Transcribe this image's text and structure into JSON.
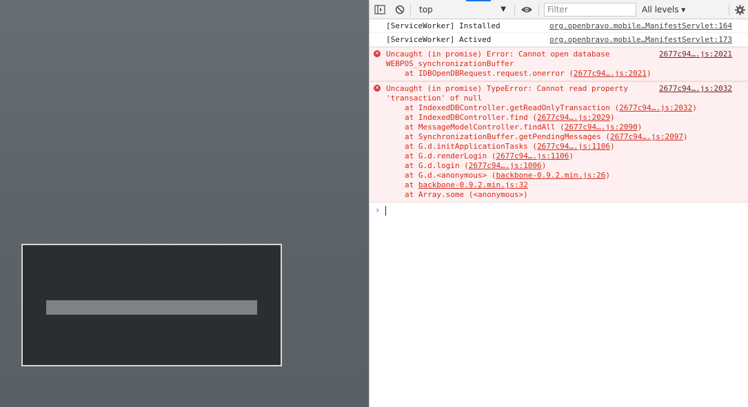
{
  "app": {
    "progress": 1.0
  },
  "devtools": {
    "toolbar": {
      "sidebar_icon": "sidebar-toggle-icon",
      "clear_icon": "clear-console-icon",
      "context": "top",
      "eye_icon": "eye-icon",
      "filter_placeholder": "Filter",
      "levels": "All levels ▾",
      "settings_icon": "gear-icon"
    },
    "messages": [
      {
        "type": "info",
        "text": "[ServiceWorker] Installed",
        "source": "org.openbravo.mobile…ManifestServlet:164"
      },
      {
        "type": "info",
        "text": "[ServiceWorker] Actived",
        "source": "org.openbravo.mobile…ManifestServlet:173"
      }
    ],
    "error1": {
      "line1": "Uncaught (in promise) Error: Cannot open database",
      "line2": "WEBPOS_synchronizationBuffer",
      "source": "2677c94….js:2021",
      "stack": [
        {
          "prefix": "at IDBOpenDBRequest.request.onerror (",
          "link": "2677c94….js:2021",
          "suffix": ")"
        }
      ]
    },
    "error2": {
      "line1": "Uncaught (in promise) TypeError: Cannot read property",
      "line2": "'transaction' of null",
      "source": "2677c94….js:2032",
      "stack": [
        {
          "prefix": "at IndexedDBController.getReadOnlyTransaction (",
          "link": "2677c94….js:2032",
          "suffix": ")"
        },
        {
          "prefix": "at IndexedDBController.find (",
          "link": "2677c94….js:2029",
          "suffix": ")"
        },
        {
          "prefix": "at MessageModelController.findAll (",
          "link": "2677c94….js:2090",
          "suffix": ")"
        },
        {
          "prefix": "at SynchronizationBuffer.getPendingMessages (",
          "link": "2677c94….js:2097",
          "suffix": ")"
        },
        {
          "prefix": "at G.d.initApplicationTasks (",
          "link": "2677c94….js:1106",
          "suffix": ")"
        },
        {
          "prefix": "at G.d.renderLogin (",
          "link": "2677c94….js:1106",
          "suffix": ")"
        },
        {
          "prefix": "at G.d.login (",
          "link": "2677c94….js:1006",
          "suffix": ")"
        },
        {
          "prefix": "at G.d.<anonymous> (",
          "link": "backbone-0.9.2.min.js:26",
          "suffix": ")"
        },
        {
          "prefix": "at ",
          "link": "backbone-0.9.2.min.js:32",
          "suffix": ""
        },
        {
          "prefix": "at Array.some (<anonymous>)",
          "link": "",
          "suffix": ""
        }
      ]
    },
    "prompt_caret": "›"
  }
}
